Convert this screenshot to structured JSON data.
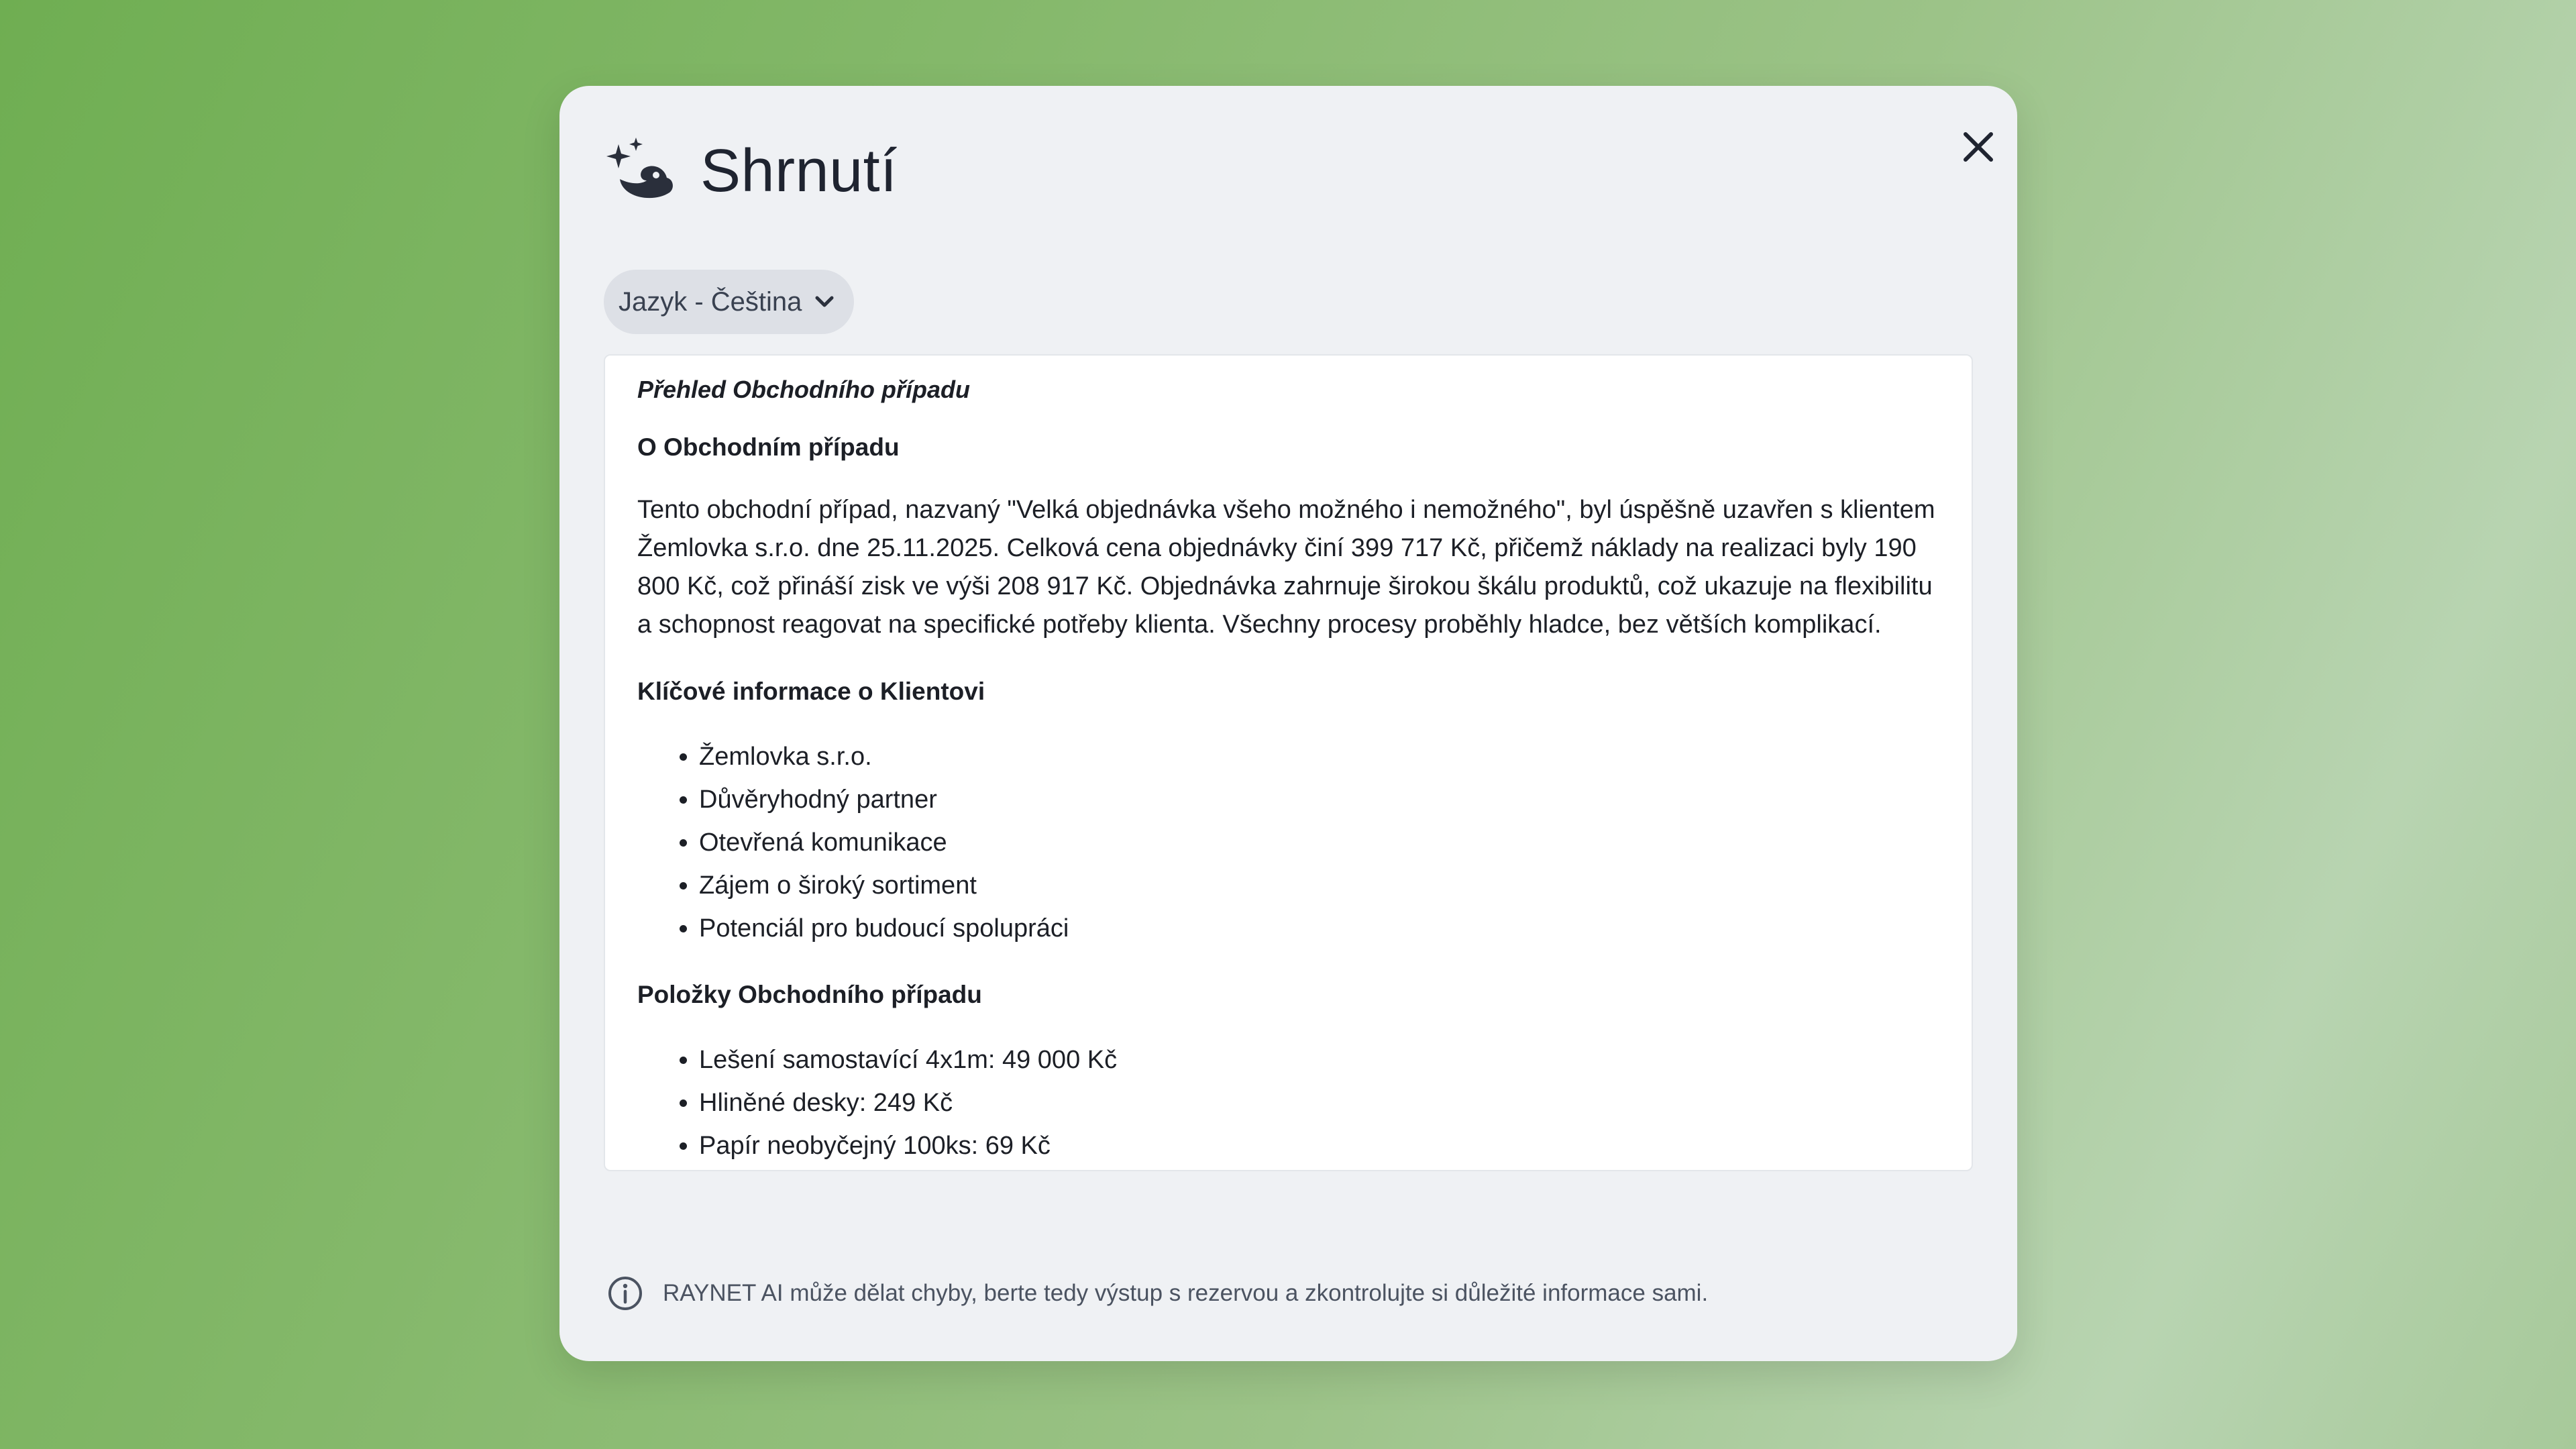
{
  "dialog": {
    "title": "Shrnutí",
    "logo_icon": "sparkle-magic-icon",
    "close_icon": "close-icon"
  },
  "language": {
    "label": "Jazyk - Čeština",
    "icon": "chevron-down-icon"
  },
  "toolbar": {
    "copy_icon": "copy-icon",
    "announce_icon": "megaphone-icon",
    "regenerate_icon": "refresh-icon"
  },
  "summary": {
    "heading": "Přehled Obchodního případu",
    "about_heading": "O Obchodním případu",
    "about_text": "Tento obchodní případ, nazvaný \"Velká objednávka všeho možného i nemožného\", byl úspěšně uzavřen s klientem Žemlovka s.r.o. dne 25.11.2025. Celková cena objednávky činí 399 717 Kč, přičemž náklady na realizaci byly 190 800 Kč, což přináší zisk ve výši 208 917 Kč. Objednávka zahrnuje širokou škálu produktů, což ukazuje na flexibilitu a schopnost reagovat na specifické potřeby klienta. Všechny procesy proběhly hladce, bez větších komplikací.",
    "client_heading": "Klíčové informace o Klientovi",
    "client_items": [
      "Žemlovka s.r.o.",
      "Důvěryhodný partner",
      "Otevřená komunikace",
      "Zájem o široký sortiment",
      "Potenciál pro budoucí spolupráci"
    ],
    "items_heading": "Položky Obchodního případu",
    "order_items": [
      "Lešení samostavící 4x1m: 49 000 Kč",
      "Hliněné desky: 249 Kč",
      "Papír neobyčejný 100ks: 69 Kč"
    ]
  },
  "disclaimer": {
    "icon": "info-icon",
    "text": "RAYNET AI může dělat chyby, berte tedy výstup s rezervou a zkontrolujte si důležité informace sami."
  },
  "colors": {
    "modal_bg": "#eff1f4",
    "text": "#1c1f26",
    "muted": "#4b5361",
    "select_bg": "#dde0e6"
  }
}
